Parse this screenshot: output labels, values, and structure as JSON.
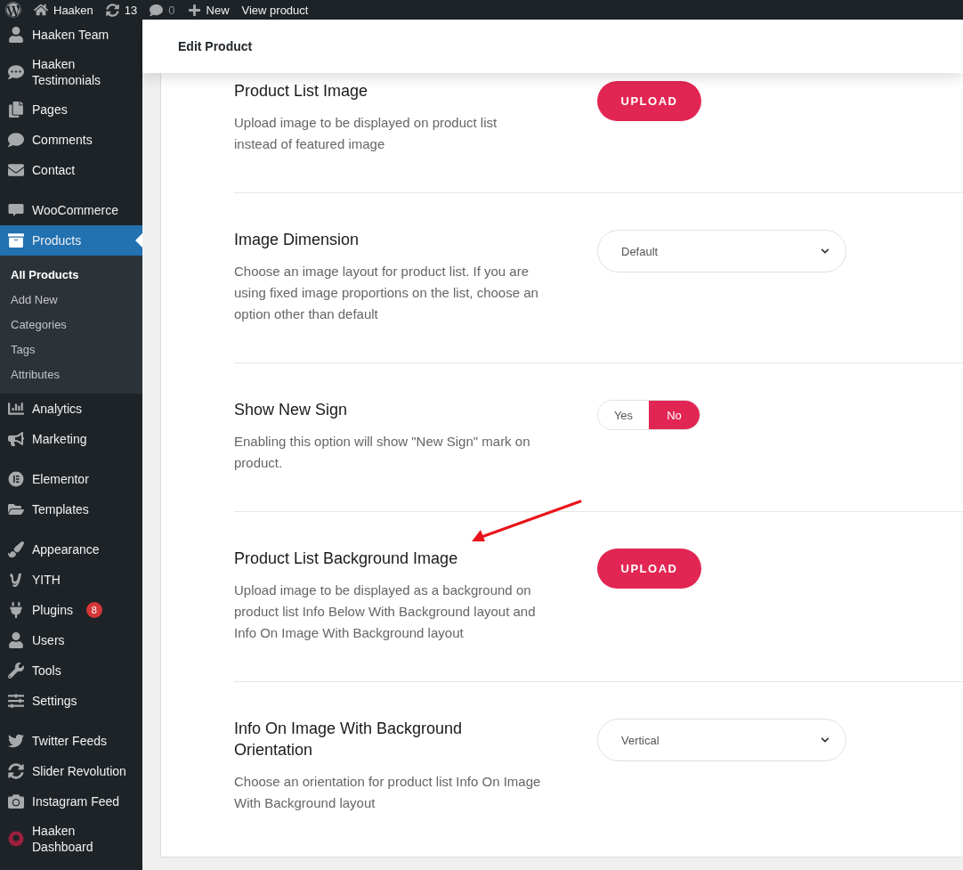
{
  "admin_bar": {
    "site": "Haaken",
    "updates": "13",
    "comments": "0",
    "new": "New",
    "view": "View product"
  },
  "sidebar": {
    "groups": [
      {
        "items": [
          {
            "label": "Haaken Team",
            "selected": false
          },
          {
            "label": "Haaken Testimonials",
            "selected": false
          },
          {
            "label": "Pages",
            "selected": false
          },
          {
            "label": "Comments",
            "selected": false
          },
          {
            "label": "Contact",
            "selected": false
          }
        ]
      },
      {
        "items": [
          {
            "label": "WooCommerce",
            "selected": false
          },
          {
            "label": "Products",
            "selected": true,
            "children": [
              {
                "label": "All Products",
                "selected": true
              },
              {
                "label": "Add New",
                "selected": false
              },
              {
                "label": "Categories",
                "selected": false
              },
              {
                "label": "Tags",
                "selected": false
              },
              {
                "label": "Attributes",
                "selected": false
              }
            ]
          },
          {
            "label": "Analytics",
            "selected": false
          },
          {
            "label": "Marketing",
            "selected": false
          }
        ]
      },
      {
        "items": [
          {
            "label": "Elementor",
            "selected": false
          },
          {
            "label": "Templates",
            "selected": false
          }
        ]
      },
      {
        "items": [
          {
            "label": "Appearance",
            "selected": false
          },
          {
            "label": "YITH",
            "selected": false
          },
          {
            "label": "Plugins",
            "selected": false,
            "badge": "8"
          },
          {
            "label": "Users",
            "selected": false
          },
          {
            "label": "Tools",
            "selected": false
          },
          {
            "label": "Settings",
            "selected": false
          }
        ]
      },
      {
        "items": [
          {
            "label": "Twitter Feeds",
            "selected": false
          },
          {
            "label": "Slider Revolution",
            "selected": false
          },
          {
            "label": "Instagram Feed",
            "selected": false
          },
          {
            "label": "Haaken Dashboard",
            "selected": false
          }
        ]
      }
    ]
  },
  "header": {
    "title": "Edit Product"
  },
  "settings": [
    {
      "kind": "upload",
      "title": "Product List Image",
      "description": "Upload image to be displayed on product list instead of featured image",
      "button": "UPLOAD"
    },
    {
      "kind": "select",
      "title": "Image Dimension",
      "description": "Choose an image layout for product list. If you are using fixed image proportions on the list, choose an option other than default",
      "value": "Default"
    },
    {
      "kind": "toggle",
      "title": "Show New Sign",
      "description": "Enabling this option will show \"New Sign\" mark on product.",
      "options": [
        {
          "label": "Yes",
          "selected": false
        },
        {
          "label": "No",
          "selected": true
        }
      ]
    },
    {
      "kind": "upload",
      "title": "Product List Background Image",
      "description": "Upload image to be displayed as a background on product list Info Below With Background layout and Info On Image With Background layout",
      "button": "UPLOAD"
    },
    {
      "kind": "select",
      "title": "Info On Image With Background Orientation",
      "description": "Choose an orientation for product list Info On Image With Background layout",
      "value": "Vertical"
    }
  ]
}
